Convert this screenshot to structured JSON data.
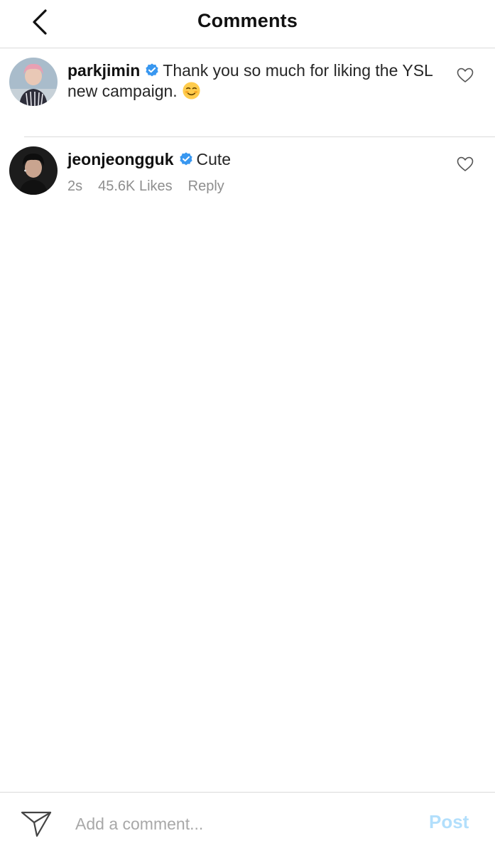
{
  "header": {
    "title": "Comments",
    "back_icon": "chevron-left-icon"
  },
  "comments": [
    {
      "username": "parkjimin",
      "verified": true,
      "text": "Thank you so much for liking the YSL new campaign.",
      "emoji": "☺️",
      "avatar_colors": {
        "hair": "#e8a6b4",
        "bg": "#9fb3c3"
      }
    },
    {
      "username": "jeonjeongguk",
      "verified": true,
      "text": "Cute",
      "time": "2s",
      "likes": "45.6K Likes",
      "reply": "Reply",
      "avatar_colors": {
        "hair": "#1a1a1a",
        "bg": "#2a2a2a"
      }
    }
  ],
  "composer": {
    "placeholder": "Add a comment...",
    "post_label": "Post",
    "send_icon": "paper-plane-icon"
  },
  "colors": {
    "verified_blue": "#3897f0",
    "post_disabled": "#b2dffc",
    "meta_gray": "#8e8e8e",
    "divider": "#dbdbdb"
  }
}
